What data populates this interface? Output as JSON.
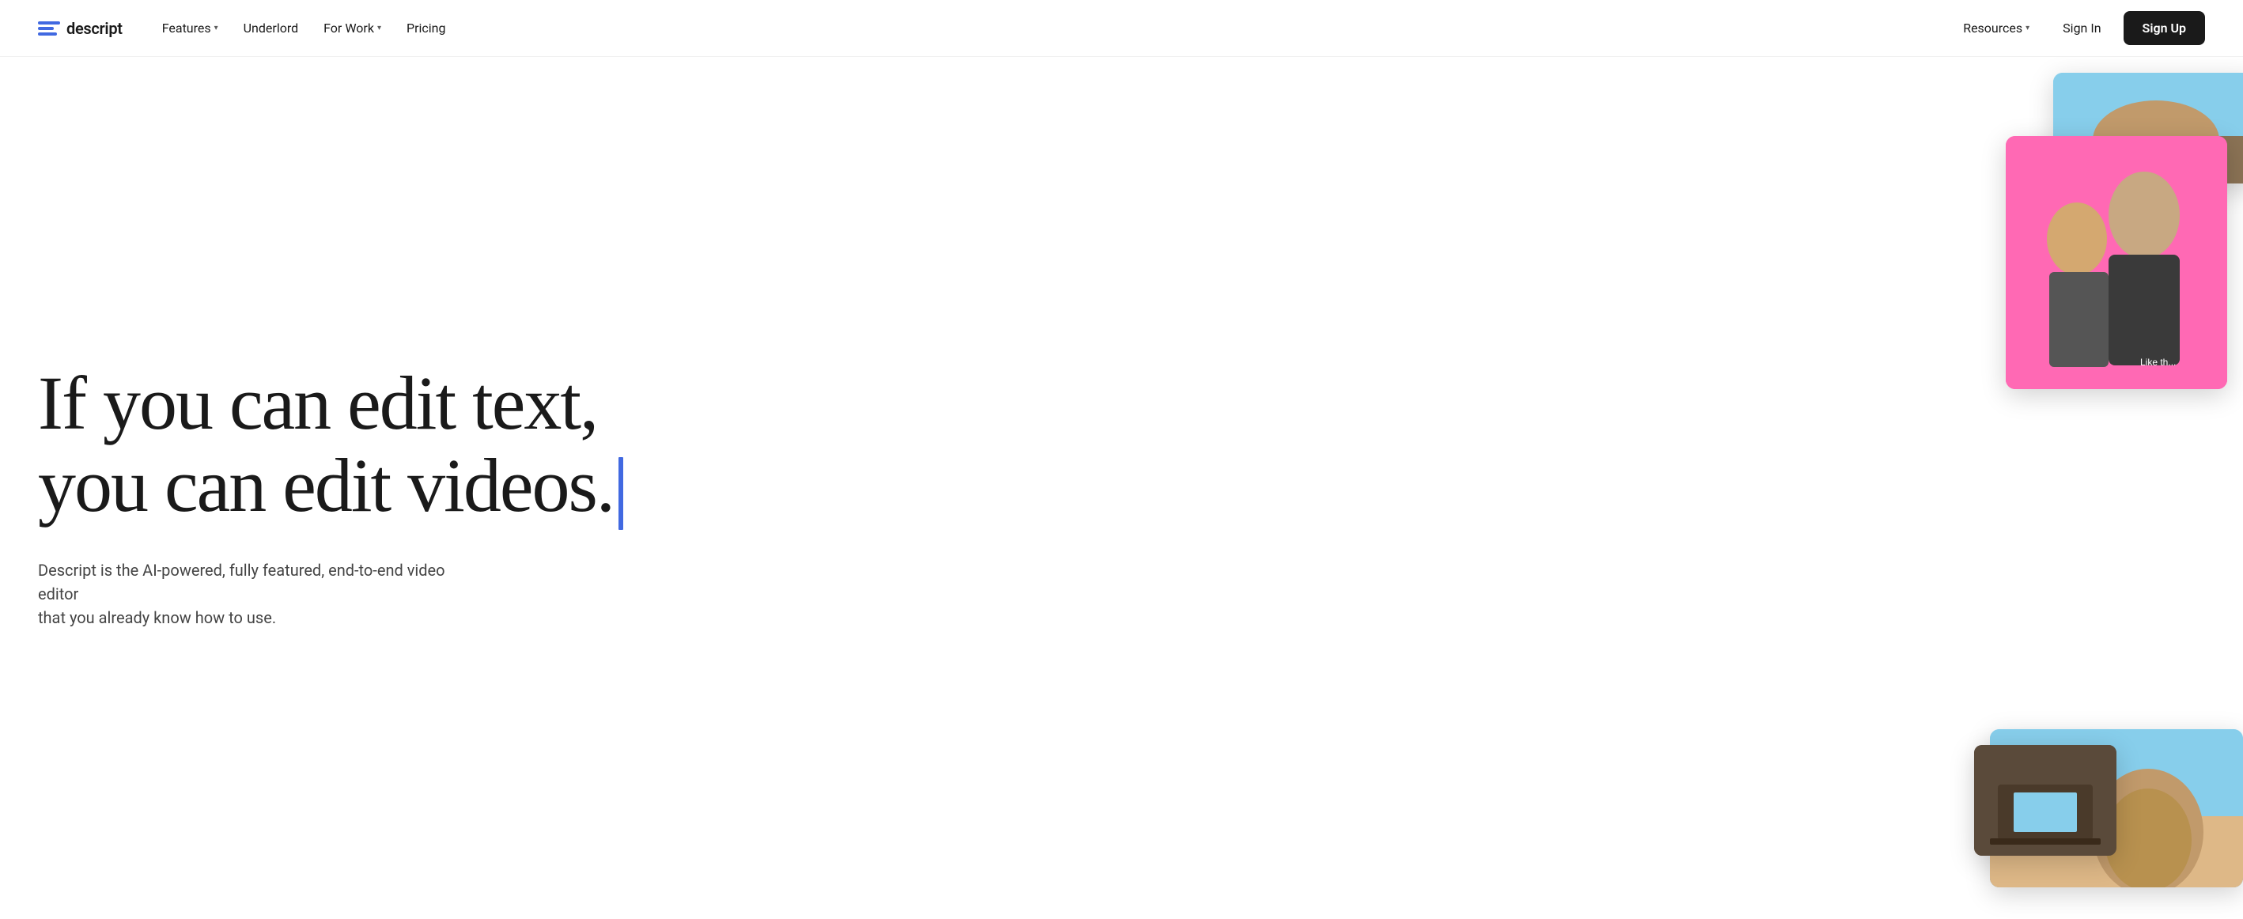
{
  "nav": {
    "logo_text": "descript",
    "links": [
      {
        "label": "Features",
        "has_dropdown": true
      },
      {
        "label": "Underlord",
        "has_dropdown": false
      },
      {
        "label": "For Work",
        "has_dropdown": true
      },
      {
        "label": "Pricing",
        "has_dropdown": false
      }
    ],
    "right": {
      "resources_label": "Resources",
      "sign_in_label": "Sign In",
      "sign_up_label": "Sign Up"
    }
  },
  "hero": {
    "headline_line1": "If you can edit text,",
    "headline_line2": "you can edit videos.",
    "subtitle_line1": "Descript is the AI-powered, fully featured, end-to-end video editor",
    "subtitle_line2": "that you already know how to use."
  },
  "colors": {
    "brand_blue": "#4169e1",
    "cursor_blue": "#4169e1",
    "text_dark": "#1a1a1a",
    "text_muted": "#444444",
    "bg_white": "#ffffff",
    "btn_bg": "#1a1a1a",
    "btn_text": "#ffffff"
  }
}
